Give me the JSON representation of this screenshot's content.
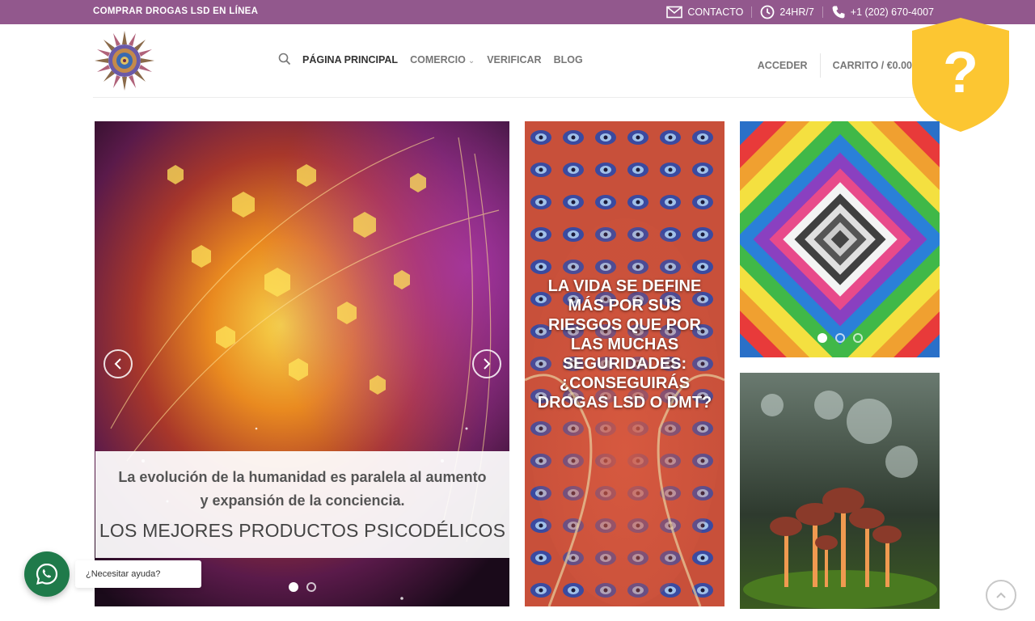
{
  "topbar": {
    "brand": "COMPRAR DROGAS LSD EN LÍNEA",
    "contact": "CONTACTO",
    "hours": "24HR/7",
    "phone": "+1 (202) 670-4007",
    "bg_color": "#92588d"
  },
  "nav": {
    "items": [
      "PÁGINA PRINCIPAL",
      "COMERCIO",
      "VERIFICAR",
      "BLOG"
    ],
    "active_index": 0
  },
  "account": {
    "login": "ACCEDER",
    "cart": "CARRITO / €0.00"
  },
  "icons": {
    "search": "search-icon",
    "mail": "mail-icon",
    "clock": "clock-icon",
    "phone": "phone-icon",
    "chevron": "chevron-down-icon",
    "shield": "shield-question-icon",
    "whatsapp": "whatsapp-icon",
    "to_top": "chevron-up-icon"
  },
  "slider": {
    "caption_sub": "La evolución de la humanidad es paralela al aumento y expansión de la conciencia.",
    "caption_head": "LOS MEJORES PRODUCTOS PSICODÉLICOS",
    "dots_count": 2,
    "active_dot": 0
  },
  "middle_banner": {
    "quote": "La vida se define más por sus riesgos que por las muchas seguridades: ¿Conseguirás drogas LSD o DMT?"
  },
  "tile1": {
    "dots_count": 3,
    "active_dot": 0
  },
  "widgets": {
    "whatsapp_label": "¿Necesitar ayuda?",
    "whatsapp_color": "#1f7a4a",
    "shield_color": "#fcc632"
  }
}
